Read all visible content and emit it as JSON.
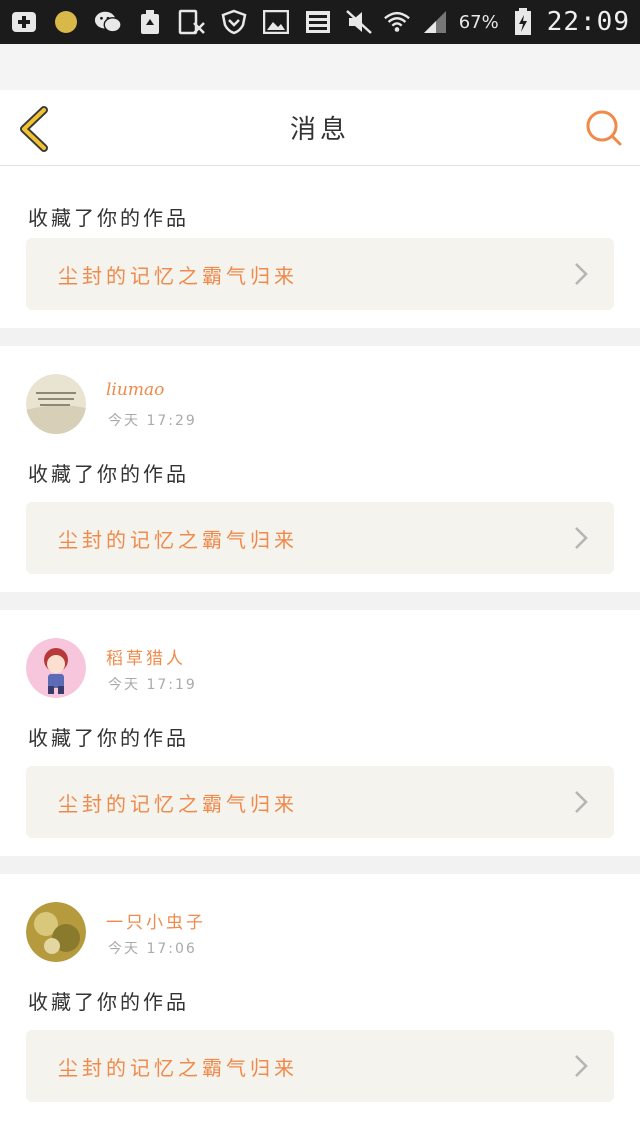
{
  "status_bar": {
    "battery_percent": "67%",
    "time": "22:09"
  },
  "header": {
    "title": "消息"
  },
  "notifications": [
    {
      "username": "",
      "time": "",
      "action": "收藏了你的作品",
      "work_title": "尘封的记忆之霸气归来"
    },
    {
      "username": "liumao",
      "time": "今天 17:29",
      "action": "收藏了你的作品",
      "work_title": "尘封的记忆之霸气归来"
    },
    {
      "username": "稻草猎人",
      "time": "今天 17:19",
      "action": "收藏了你的作品",
      "work_title": "尘封的记忆之霸气归来"
    },
    {
      "username": "一只小虫子",
      "time": "今天 17:06",
      "action": "收藏了你的作品",
      "work_title": "尘封的记忆之霸气归来"
    }
  ],
  "colors": {
    "accent": "#f08a4b",
    "back_arrow": "#f2c230"
  }
}
